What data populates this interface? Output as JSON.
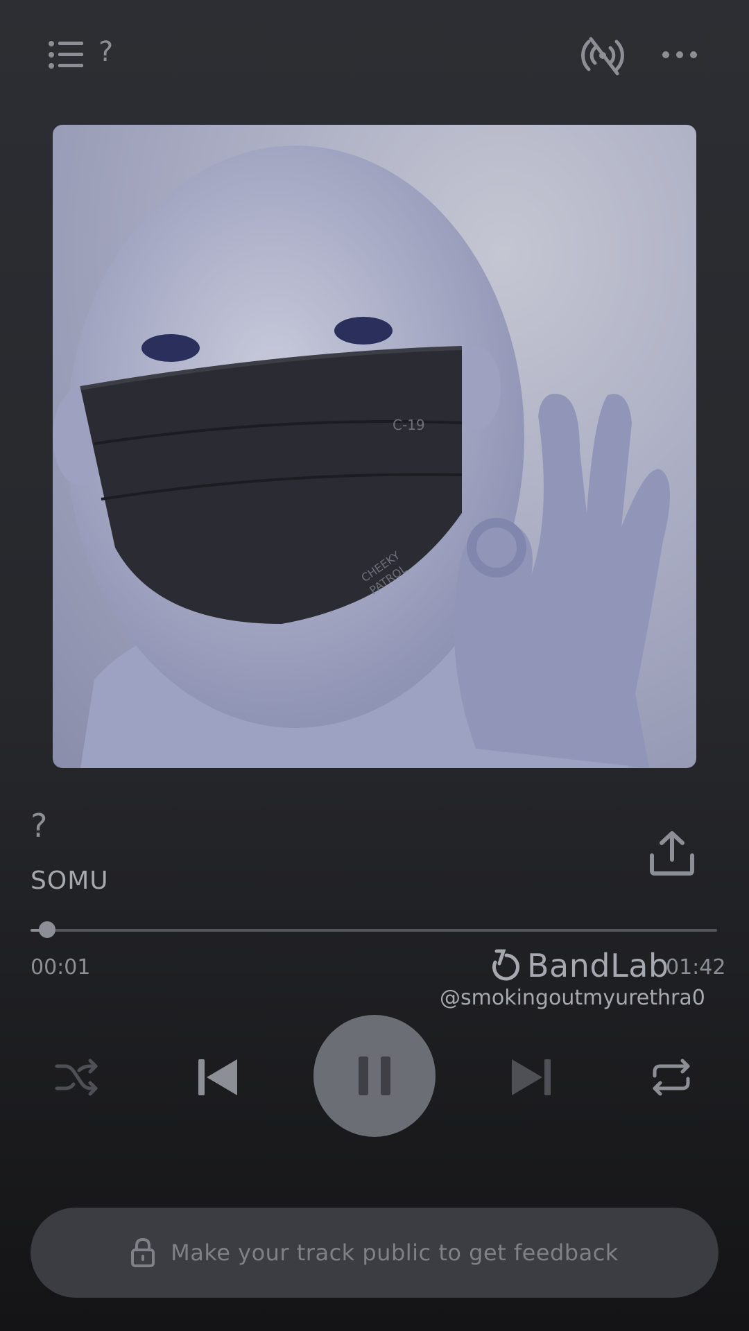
{
  "header": {
    "track_title_short": "?",
    "queue_icon": "list-icon",
    "broadcast_icon": "broadcast-off-icon",
    "more_icon": "more-horizontal-icon"
  },
  "track": {
    "title": "?",
    "artist": "SOMU",
    "share_icon": "share-upload-icon"
  },
  "artwork": {
    "mask_text_1": "C-19",
    "mask_text_2": "CHEEKY",
    "mask_text_3": "PATROL"
  },
  "progress": {
    "elapsed": "00:01",
    "total": "01:42",
    "fraction": 0.01
  },
  "watermark": {
    "brand": "BandLab",
    "handle": "@smokingoutmyurethra0"
  },
  "controls": {
    "shuffle_icon": "shuffle-icon",
    "prev_icon": "skip-previous-icon",
    "play_state": "playing",
    "pause_icon": "pause-icon",
    "next_icon": "skip-next-icon",
    "repeat_icon": "repeat-icon"
  },
  "feedback": {
    "label": "Make your track public to get feedback",
    "icon": "lock-icon"
  },
  "colors": {
    "background": "#2a2b30",
    "accent": "#8d8f96",
    "button": "#3b3d42"
  }
}
